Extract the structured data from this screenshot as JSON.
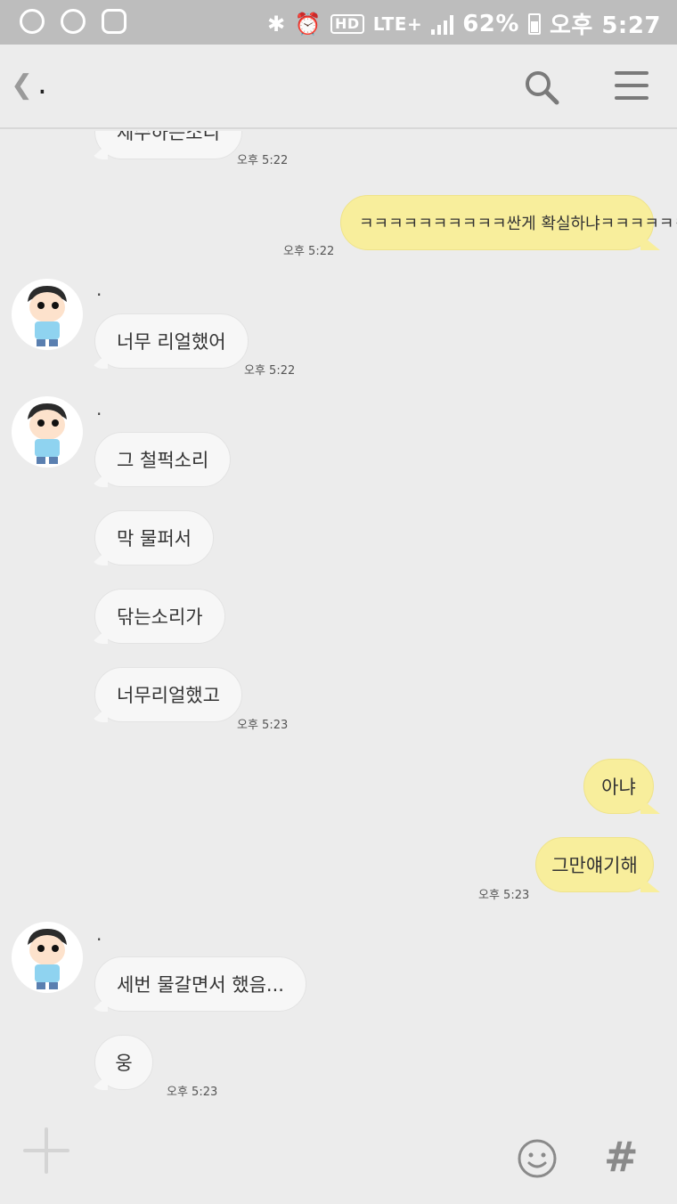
{
  "status_bar": {
    "battery": "62%",
    "time": "오후 5:27",
    "network": "LTE+",
    "hd": "HD"
  },
  "header": {
    "back_glyph": "❮",
    "title": "."
  },
  "messages": [
    {
      "text": "제수하는소리",
      "time": "오후 5:22"
    },
    {
      "text": "ㅋㅋㅋㅋㅋㅋㅋㅋㅋㅋ싼게 확실하냐ㅋㅋㅋㅋㅋㅋㅋ",
      "time": "오후 5:22"
    },
    {
      "sender": ".",
      "text": "너무 리얼했어",
      "time": "오후 5:22"
    },
    {
      "sender": ".",
      "text": "그 철퍽소리"
    },
    {
      "text": "막 물퍼서"
    },
    {
      "text": "닦는소리가"
    },
    {
      "text": "너무리얼했고",
      "time": "오후 5:23"
    },
    {
      "text": "아냐"
    },
    {
      "text": "그만얘기해",
      "time": "오후 5:23"
    },
    {
      "sender": ".",
      "text": "세번 물갈면서 했음..."
    },
    {
      "text": "웅",
      "time": "오후 5:23"
    }
  ],
  "input_bar": {
    "hash_glyph": "#"
  },
  "colors": {
    "incoming_bubble": "#f7f7f7",
    "outgoing_bubble": "#f8ee9c",
    "background": "#ececec",
    "status_bar": "#bdbdbd"
  }
}
